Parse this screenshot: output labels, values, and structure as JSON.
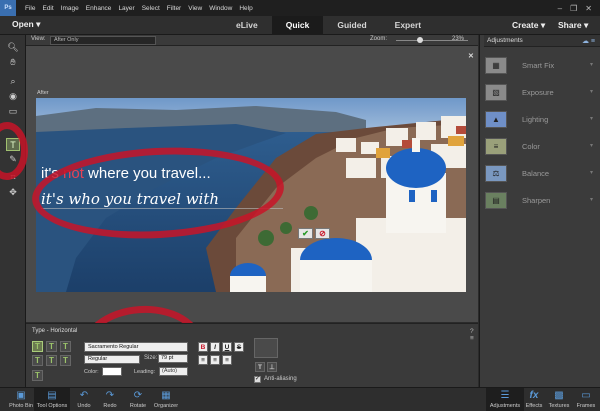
{
  "menubar": {
    "logo": "Ps",
    "items": [
      "File",
      "Edit",
      "Image",
      "Enhance",
      "Layer",
      "Select",
      "Filter",
      "View",
      "Window",
      "Help"
    ]
  },
  "modebar": {
    "open": "Open ▾",
    "tabs": [
      {
        "label": "eLive",
        "active": false
      },
      {
        "label": "Quick",
        "active": true
      },
      {
        "label": "Guided",
        "active": false
      },
      {
        "label": "Expert",
        "active": false
      }
    ],
    "create": "Create ▾",
    "share": "Share ▾"
  },
  "optbar": {
    "view_label": "View:",
    "view_value": "After Only",
    "zoom_label": "Zoom:",
    "zoom_value": "23%",
    "zoom_fraction": 0.33
  },
  "canvas": {
    "after_label": "After",
    "close": "✕",
    "line1_a": "it's ",
    "line1_b": "not",
    "line1_c": " where you travel...",
    "line2": "it's who you travel with",
    "commit": "✔",
    "cancel": "⊘"
  },
  "adjustments": {
    "title": "Adjustments",
    "items": [
      {
        "label": "Smart Fix",
        "icon": "smart-fix-icon"
      },
      {
        "label": "Exposure",
        "icon": "exposure-icon"
      },
      {
        "label": "Lighting",
        "icon": "lighting-icon"
      },
      {
        "label": "Color",
        "icon": "color-icon"
      },
      {
        "label": "Balance",
        "icon": "balance-icon"
      },
      {
        "label": "Sharpen",
        "icon": "sharpen-icon"
      }
    ]
  },
  "type_options": {
    "title": "Type - Horizontal",
    "font": "Sacramento Regular",
    "style": "Regular",
    "size_label": "Size:",
    "size": "79 pt",
    "color_label": "Color:",
    "leading_label": "Leading:",
    "leading": "(Auto)",
    "bold": "B",
    "italic": "I",
    "underline": "U",
    "strike": "S",
    "antialias_label": "Anti-aliasing",
    "antialias_checked": "✓"
  },
  "taskbar": {
    "left": [
      {
        "label": "Photo Bin",
        "icon": "photo-bin-icon"
      },
      {
        "label": "Tool Options",
        "icon": "tool-options-icon"
      },
      {
        "label": "Undo",
        "icon": "undo-icon"
      },
      {
        "label": "Redo",
        "icon": "redo-icon"
      },
      {
        "label": "Rotate",
        "icon": "rotate-icon"
      },
      {
        "label": "Organizer",
        "icon": "organizer-icon"
      }
    ],
    "right": [
      {
        "label": "Adjustments",
        "icon": "adjustments-icon"
      },
      {
        "label": "Effects",
        "icon": "effects-icon"
      },
      {
        "label": "Textures",
        "icon": "textures-icon"
      },
      {
        "label": "Frames",
        "icon": "frames-icon"
      }
    ]
  },
  "colors": {
    "highlight": "#c81428",
    "accent": "#9bc36a"
  }
}
